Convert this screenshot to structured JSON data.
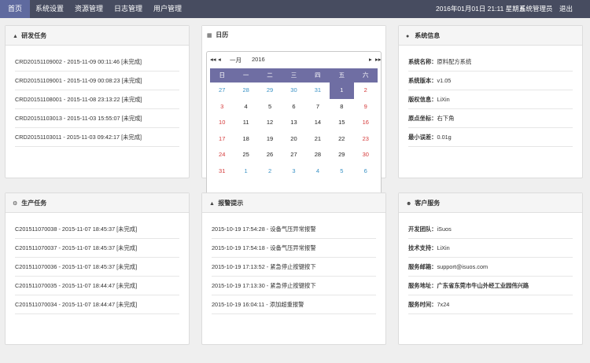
{
  "nav": {
    "items": [
      "首页",
      "系统设置",
      "资源管理",
      "日志管理",
      "用户管理"
    ],
    "datetime": "2016年01月01日 21:11 星期五",
    "user": "系统管理员",
    "logout": "退出"
  },
  "rd_tasks": {
    "title": "研发任务",
    "items": [
      "CRD20151109002 - 2015-11-09 00:11:46 [未完成]",
      "CRD20151109001 - 2015-11-09 00:08:23 [未完成]",
      "CRD20151108001 - 2015-11-08 23:13:22 [未完成]",
      "CRD20151103013 - 2015-11-03 15:55:07 [未完成]",
      "CRD20151103011 - 2015-11-03 09:42:17 [未完成]"
    ]
  },
  "calendar": {
    "title": "日历",
    "month": "一月",
    "year": "2016",
    "nav": {
      "prev_year": "◂◂",
      "prev_month": "◂",
      "next_month": "▸",
      "next_year": "▸▸"
    },
    "weekdays": [
      "日",
      "一",
      "二",
      "三",
      "四",
      "五",
      "六"
    ],
    "weeks": [
      [
        "27",
        "28",
        "29",
        "30",
        "31",
        "1",
        "2"
      ],
      [
        "3",
        "4",
        "5",
        "6",
        "7",
        "8",
        "9"
      ],
      [
        "10",
        "11",
        "12",
        "13",
        "14",
        "15",
        "16"
      ],
      [
        "17",
        "18",
        "19",
        "20",
        "21",
        "22",
        "23"
      ],
      [
        "24",
        "25",
        "26",
        "27",
        "28",
        "29",
        "30"
      ],
      [
        "31",
        "1",
        "2",
        "3",
        "4",
        "5",
        "6"
      ]
    ],
    "selected": "1",
    "colors": {
      "header": "#6f6ea3",
      "other_month": "#3a92c5",
      "weekend": "#d53a3a"
    }
  },
  "system_info": {
    "title": "系统信息",
    "rows": [
      {
        "k": "系统名称：",
        "v": "原料配方系统"
      },
      {
        "k": "系统版本：",
        "v": "v1.05"
      },
      {
        "k": "版权信息：",
        "v": "LiXin"
      },
      {
        "k": "原点坐标：",
        "v": "右下角"
      },
      {
        "k": "最小误差：",
        "v": "0.01g"
      }
    ]
  },
  "production_tasks": {
    "title": "生产任务",
    "items": [
      "C201511070038 - 2015-11-07 18:45:37 [未完成]",
      "C201511070037 - 2015-11-07 18:45:37 [未完成]",
      "C201511070036 - 2015-11-07 18:45:37 [未完成]",
      "C201511070035 - 2015-11-07 18:44:47 [未完成]",
      "C201511070034 - 2015-11-07 18:44:47 [未完成]"
    ]
  },
  "alarms": {
    "title": "报警提示",
    "items": [
      "2015-10-19 17:54:28 - 设备气压异常报警",
      "2015-10-19 17:54:18 - 设备气压异常报警",
      "2015-10-19 17:13:52 - 紧急停止按键按下",
      "2015-10-19 17:13:30 - 紧急停止按键按下",
      "2015-10-19 16:04:11 - 添加超重报警"
    ]
  },
  "customer_service": {
    "title": "客户服务",
    "rows": [
      {
        "k": "开发团队：",
        "v": "iSuos"
      },
      {
        "k": "技术支持：",
        "v": "LiXin"
      },
      {
        "k": "服务邮箱：",
        "v": "support@isuos.com"
      },
      {
        "k": "服务地址：",
        "v": "广东省东莞市牛山外经工业园伟兴路"
      },
      {
        "k": "服务时间：",
        "v": "7x24"
      }
    ]
  },
  "icons": {
    "rd_tasks": "flask-icon",
    "calendar": "calendar-icon",
    "system_info": "info-circle-icon",
    "production_tasks": "gears-icon",
    "alarms": "warning-icon",
    "customer_service": "users-icon"
  }
}
